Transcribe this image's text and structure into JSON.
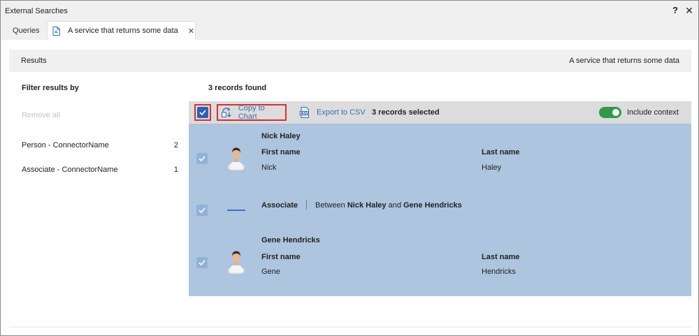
{
  "window": {
    "title": "External Searches",
    "help_label": "?",
    "close_label": "✕"
  },
  "tabs": [
    {
      "label": "Queries"
    },
    {
      "label": "A service that returns some data",
      "close_label": "✕"
    }
  ],
  "results": {
    "label": "Results",
    "source": "A service that returns some data"
  },
  "filter": {
    "title": "Filter results by",
    "remove_all": "Remove all",
    "items": [
      {
        "label": "Person - ConnectorName",
        "count": "2"
      },
      {
        "label": "Associate - ConnectorName",
        "count": "1"
      }
    ]
  },
  "records_found": "3 records found",
  "toolbar": {
    "copy_to_chart": "Copy to Chart",
    "export_csv": "Export to CSV",
    "selected": "3 records selected",
    "include_context": "Include context",
    "include_context_on": true
  },
  "records": [
    {
      "name": "Nick Haley",
      "first_name_label": "First name",
      "first_name": "Nick",
      "last_name_label": "Last name",
      "last_name": "Haley"
    },
    {
      "type": "Associate",
      "between_label": "Between",
      "from": "Nick Haley",
      "and_label": "and",
      "to": "Gene Hendricks"
    },
    {
      "name": "Gene Hendricks",
      "first_name_label": "First name",
      "first_name": "Gene",
      "last_name_label": "Last name",
      "last_name": "Hendricks"
    }
  ],
  "colors": {
    "accent": "#2a62b7",
    "highlight_border": "#d9302b",
    "selection_bg": "#adc5de",
    "toggle_on": "#2e9a4a"
  }
}
